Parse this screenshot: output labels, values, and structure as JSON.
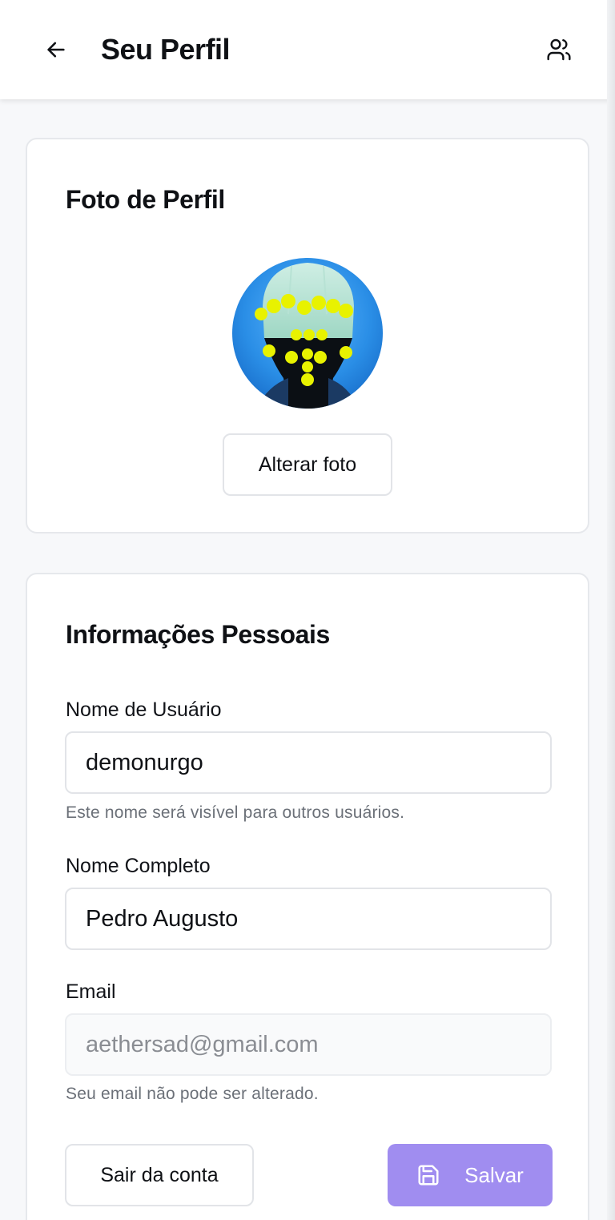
{
  "header": {
    "title": "Seu Perfil",
    "back_icon": "arrow-left-icon",
    "users_icon": "users-icon"
  },
  "photo_card": {
    "title": "Foto de Perfil",
    "change_photo_label": "Alterar foto"
  },
  "info_card": {
    "title": "Informações Pessoais",
    "username": {
      "label": "Nome de Usuário",
      "value": "demonurgo",
      "helper": "Este nome será visível para outros usuários."
    },
    "full_name": {
      "label": "Nome Completo",
      "value": "Pedro Augusto"
    },
    "email": {
      "label": "Email",
      "value": "aethersad@gmail.com",
      "helper": "Seu email não pode ser alterado."
    },
    "logout_label": "Sair da conta",
    "save_label": "Salvar",
    "save_icon": "save-icon"
  },
  "colors": {
    "primary_disabled": "#a08df0",
    "border": "#e2e4e8",
    "background": "#f7f8fa"
  }
}
